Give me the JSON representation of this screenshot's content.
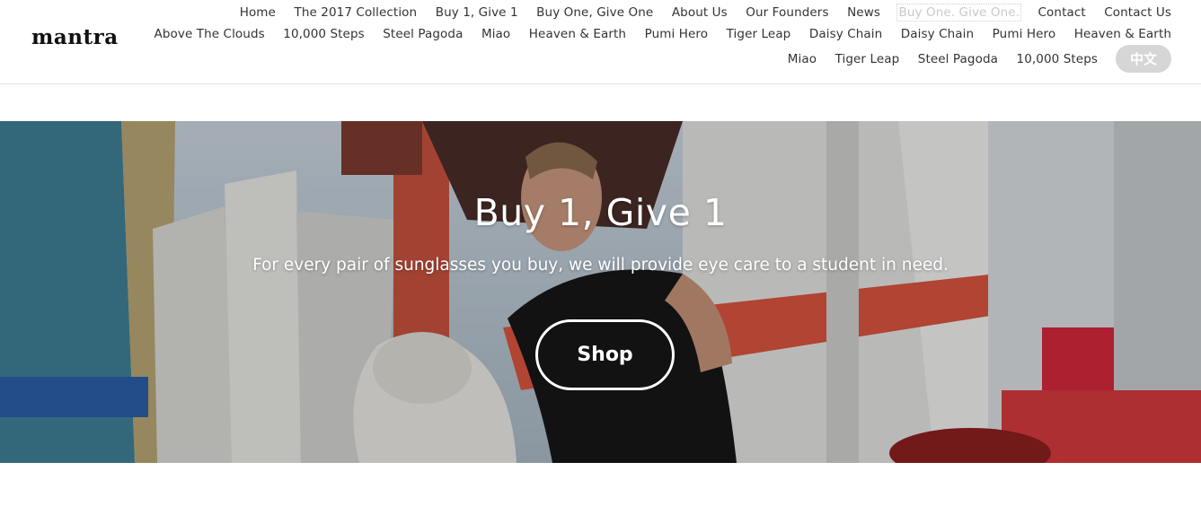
{
  "brand": {
    "logo_text": "mantra"
  },
  "nav": {
    "row1": [
      {
        "label": "Home"
      },
      {
        "label": "The 2017 Collection"
      },
      {
        "label": "Buy 1, Give 1"
      },
      {
        "label": "Buy One, Give One"
      },
      {
        "label": "About Us"
      },
      {
        "label": "Our Founders"
      },
      {
        "label": "News"
      },
      {
        "label": "Buy One. Give One.",
        "active": true
      },
      {
        "label": "Contact"
      },
      {
        "label": "Contact Us"
      }
    ],
    "row2": [
      {
        "label": "Above The Clouds"
      },
      {
        "label": "10,000 Steps"
      },
      {
        "label": "Steel Pagoda"
      },
      {
        "label": "Miao"
      },
      {
        "label": "Heaven & Earth"
      },
      {
        "label": "Pumi Hero"
      },
      {
        "label": "Tiger Leap"
      },
      {
        "label": "Daisy Chain"
      },
      {
        "label": "Daisy Chain"
      },
      {
        "label": "Pumi Hero"
      },
      {
        "label": "Heaven & Earth"
      }
    ],
    "row3": [
      {
        "label": "Miao"
      },
      {
        "label": "Tiger Leap"
      },
      {
        "label": "Steel Pagoda"
      },
      {
        "label": "10,000 Steps"
      }
    ],
    "language_button": "中文"
  },
  "hero": {
    "title": "Buy 1, Give 1",
    "subtitle": "For every pair of sunglasses you buy, we will provide eye care to a student in need.",
    "cta_label": "Shop"
  },
  "colors": {
    "nav_text": "#333333",
    "nav_active": "#c9c9c9",
    "language_button_bg": "#d6d6d6",
    "hero_text": "#ffffff"
  }
}
